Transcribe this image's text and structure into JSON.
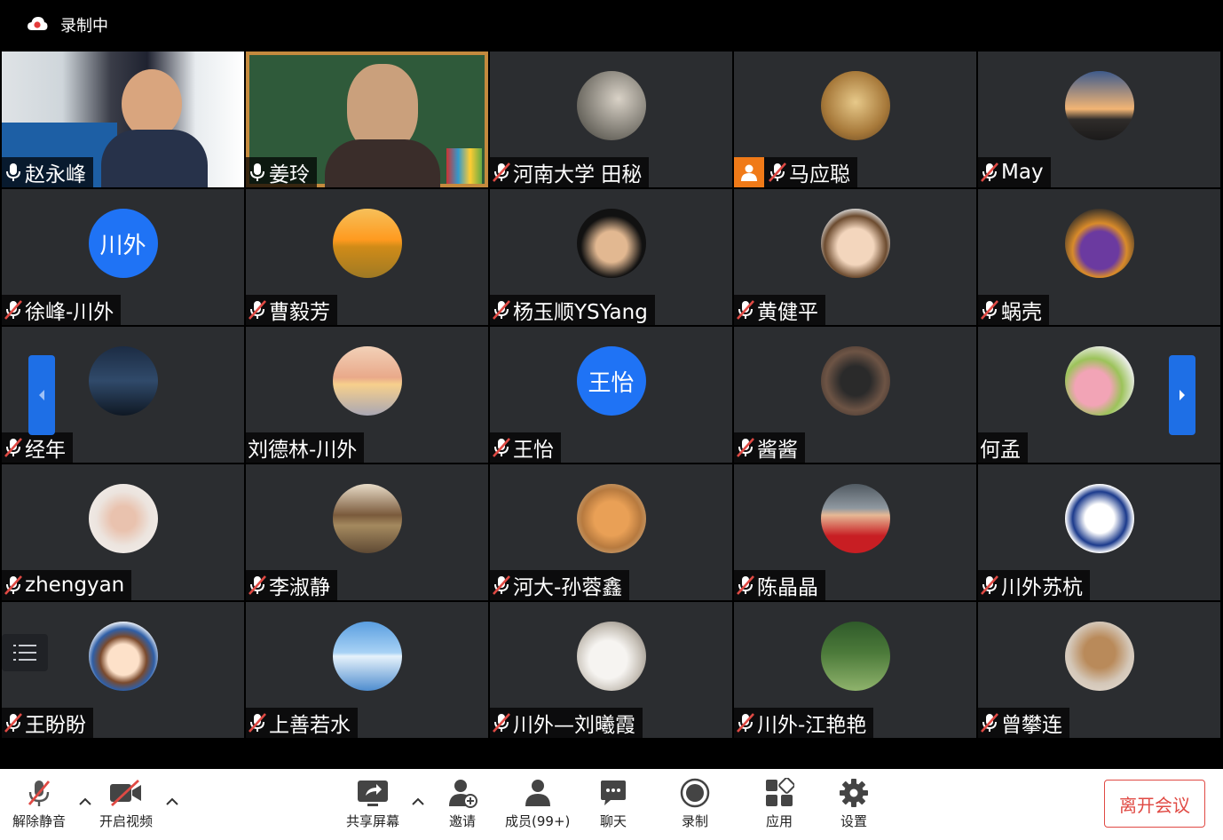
{
  "recording": {
    "label": "录制中"
  },
  "participants": [
    {
      "name": "赵永峰",
      "mic": "on",
      "video": true,
      "bg": "room"
    },
    {
      "name": "姜玲",
      "mic": "on",
      "video": true,
      "bg": "board"
    },
    {
      "name": "河南大学 田秘",
      "mic": "muted",
      "avatar": "photo-portrait"
    },
    {
      "name": "马应聪",
      "mic": "muted",
      "avatar": "photo-compass",
      "host": true
    },
    {
      "name": "May",
      "mic": "muted",
      "avatar": "photo-sunset-sky"
    },
    {
      "name": "徐峰-川外",
      "mic": "muted",
      "avatar_text": "川外"
    },
    {
      "name": "曹毅芳",
      "mic": "muted",
      "avatar": "photo-sunrise-field"
    },
    {
      "name": "杨玉顺YSYang",
      "mic": "muted",
      "avatar": "photo-smiling-man"
    },
    {
      "name": "黄健平",
      "mic": "muted",
      "avatar": "photo-child-cartoon"
    },
    {
      "name": "蜗壳",
      "mic": "muted",
      "avatar": "photo-basketball"
    },
    {
      "name": "经年",
      "mic": "muted",
      "avatar": "photo-night-girl"
    },
    {
      "name": "刘德林-川外",
      "mic": "none",
      "avatar": "photo-sea-sunset"
    },
    {
      "name": "王怡",
      "mic": "muted",
      "avatar_text": "王怡"
    },
    {
      "name": "酱酱",
      "mic": "muted",
      "avatar": "photo-library"
    },
    {
      "name": "何孟",
      "mic": "none",
      "avatar": "photo-patrick"
    },
    {
      "name": "zhengyan",
      "mic": "muted",
      "avatar": "photo-heart-hands"
    },
    {
      "name": "李淑静",
      "mic": "muted",
      "avatar": "photo-house-lake"
    },
    {
      "name": "河大-孙蓉鑫",
      "mic": "muted",
      "avatar": "photo-cat"
    },
    {
      "name": "陈晶晶",
      "mic": "muted",
      "avatar": "photo-kid-red"
    },
    {
      "name": "川外苏杭",
      "mic": "muted",
      "avatar": "photo-panda-meme"
    },
    {
      "name": "王盼盼",
      "mic": "muted",
      "avatar": "photo-cartoon-girl"
    },
    {
      "name": "上善若水",
      "mic": "muted",
      "avatar": "photo-sky-water"
    },
    {
      "name": "川外—刘曦霞",
      "mic": "muted",
      "avatar": "photo-white-dog"
    },
    {
      "name": "川外-江艳艳",
      "mic": "muted",
      "avatar": "photo-swing-forest"
    },
    {
      "name": "曾攀连",
      "mic": "muted",
      "avatar": "photo-teddy-bear"
    }
  ],
  "toolbar": {
    "unmute": "解除静音",
    "start_video": "开启视频",
    "share_screen": "共享屏幕",
    "invite": "邀请",
    "members": "成员(99+)",
    "chat": "聊天",
    "record": "录制",
    "apps": "应用",
    "settings": "设置",
    "leave": "离开会议"
  },
  "colors": {
    "accent": "#1e6fe6",
    "tile": "#2b2d30",
    "host": "#f07a18",
    "mute": "#e04a44"
  }
}
